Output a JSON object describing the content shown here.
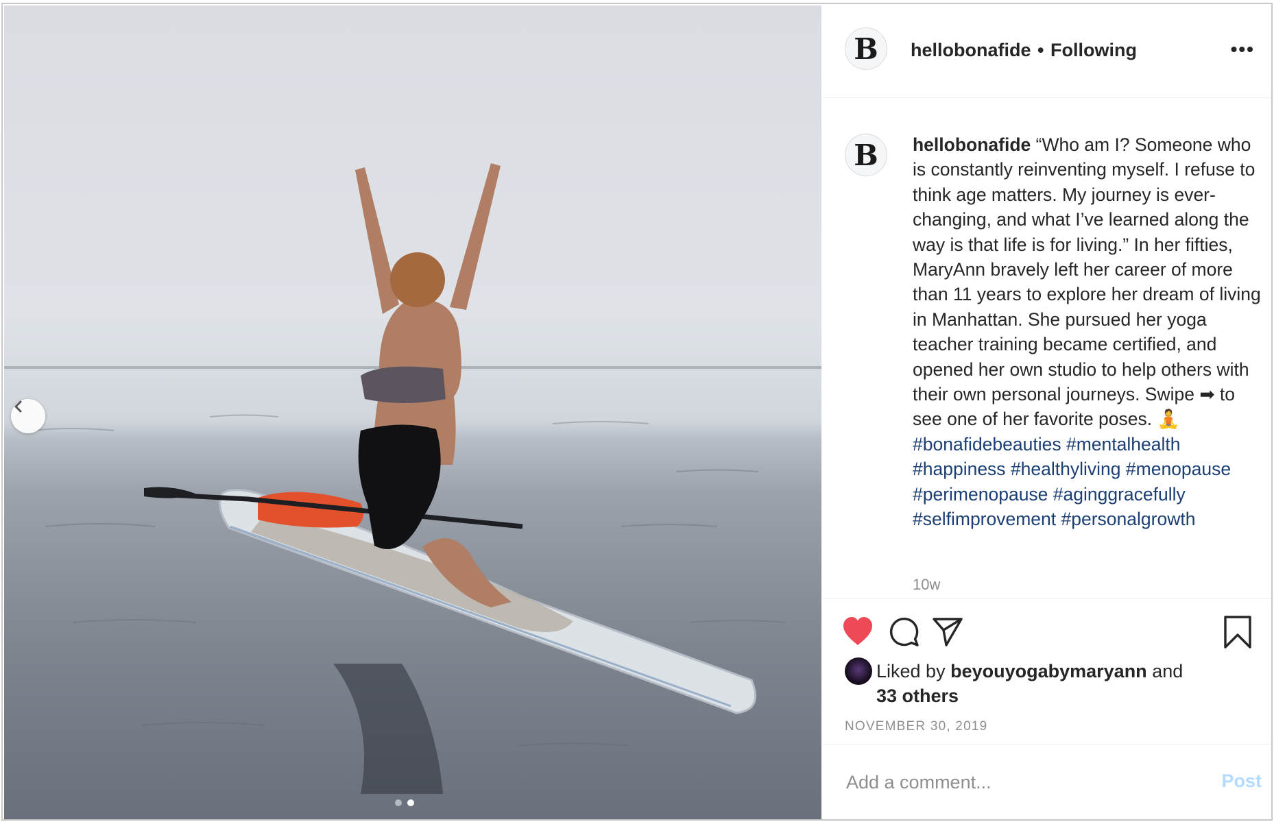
{
  "post": {
    "username": "hellobonafide",
    "follow_status": "Following",
    "separator": "•",
    "more_label": "•••",
    "avatar_letter": "B"
  },
  "caption": {
    "username": "hellobonafide",
    "text": "“Who am I? Someone who is constantly reinventing myself. I refuse to think age matters. My journey is ever-changing, and what I’ve learned along the way is that life is for living.” In her fifties, MaryAnn bravely left her career of more than 11 years to explore her dream of living in Manhattan. She pursued her yoga teacher training became certified, and opened her own studio to help others with their own personal journeys. Swipe ➡ to see one of her favorite poses. 🧘",
    "hashtags": [
      "#bonafidebeauties",
      "#mentalhealth",
      "#happiness",
      "#healthyliving",
      "#menopause",
      "#perimenopause",
      "#aginggracefully",
      "#selfimprovement",
      "#personalgrowth"
    ],
    "age": "10w"
  },
  "actions": {
    "liked_prefix": "Liked by",
    "liked_user": "beyouyogabymaryann",
    "liked_and": "and",
    "liked_others": "33 others",
    "date": "NOVEMBER 30, 2019",
    "heart_color": "#ed4956",
    "icons": [
      "heart-filled-icon",
      "comment-icon",
      "share-icon",
      "bookmark-icon"
    ]
  },
  "comment": {
    "placeholder": "Add a comment...",
    "post_label": "Post",
    "post_color": "#b3dbff"
  },
  "carousel": {
    "slides": 2,
    "active_index": 1,
    "prev_icon": "chevron-left-icon"
  }
}
